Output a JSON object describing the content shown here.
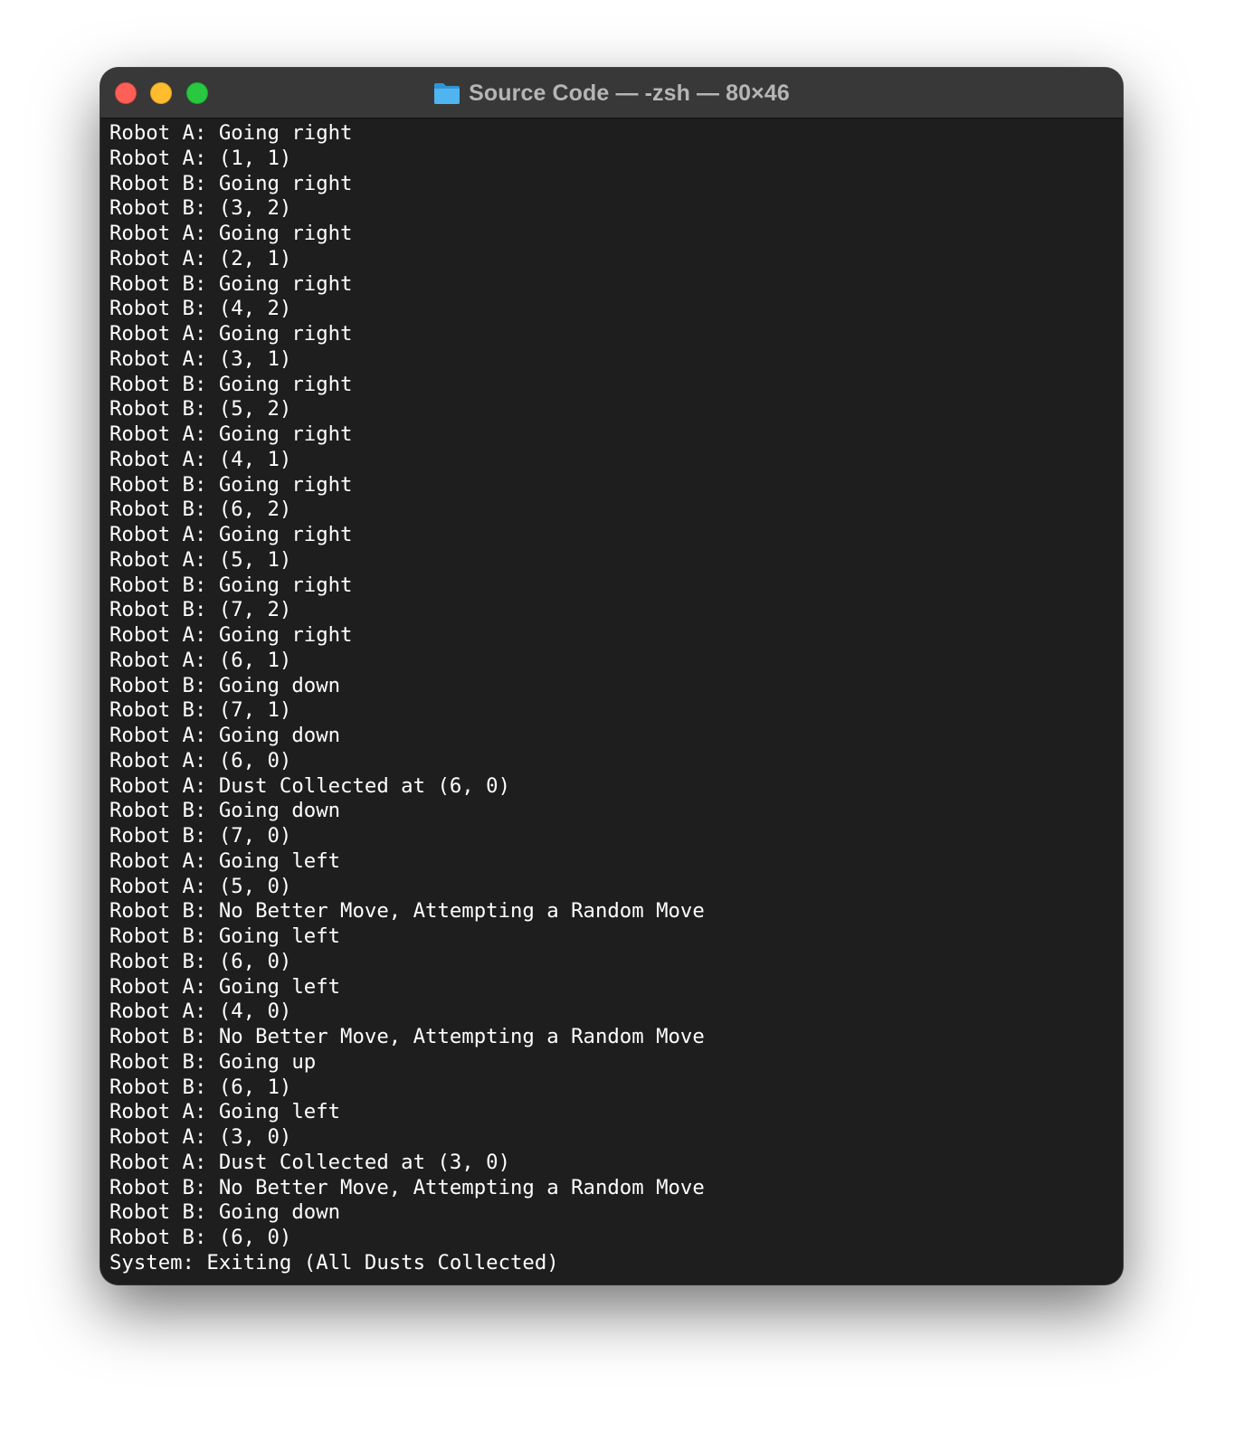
{
  "window": {
    "title": "Source Code — -zsh — 80×46"
  },
  "icons": {
    "folder": "folder-icon",
    "close": "close-button",
    "minimize": "minimize-button",
    "zoom": "zoom-button"
  },
  "colors": {
    "terminal_bg": "#1e1e1e",
    "titlebar_bg": "#383838",
    "text": "#ffffff",
    "close": "#fe5f57",
    "minimize": "#febc2e",
    "zoom": "#28c840",
    "folder": "#3aa8e8"
  },
  "terminal": {
    "lines": [
      "Robot A: Going right",
      "Robot A: (1, 1)",
      "Robot B: Going right",
      "Robot B: (3, 2)",
      "Robot A: Going right",
      "Robot A: (2, 1)",
      "Robot B: Going right",
      "Robot B: (4, 2)",
      "Robot A: Going right",
      "Robot A: (3, 1)",
      "Robot B: Going right",
      "Robot B: (5, 2)",
      "Robot A: Going right",
      "Robot A: (4, 1)",
      "Robot B: Going right",
      "Robot B: (6, 2)",
      "Robot A: Going right",
      "Robot A: (5, 1)",
      "Robot B: Going right",
      "Robot B: (7, 2)",
      "Robot A: Going right",
      "Robot A: (6, 1)",
      "Robot B: Going down",
      "Robot B: (7, 1)",
      "Robot A: Going down",
      "Robot A: (6, 0)",
      "Robot A: Dust Collected at (6, 0)",
      "Robot B: Going down",
      "Robot B: (7, 0)",
      "Robot A: Going left",
      "Robot A: (5, 0)",
      "Robot B: No Better Move, Attempting a Random Move",
      "Robot B: Going left",
      "Robot B: (6, 0)",
      "Robot A: Going left",
      "Robot A: (4, 0)",
      "Robot B: No Better Move, Attempting a Random Move",
      "Robot B: Going up",
      "Robot B: (6, 1)",
      "Robot A: Going left",
      "Robot A: (3, 0)",
      "Robot A: Dust Collected at (3, 0)",
      "Robot B: No Better Move, Attempting a Random Move",
      "Robot B: Going down",
      "Robot B: (6, 0)",
      "System: Exiting (All Dusts Collected)"
    ]
  }
}
